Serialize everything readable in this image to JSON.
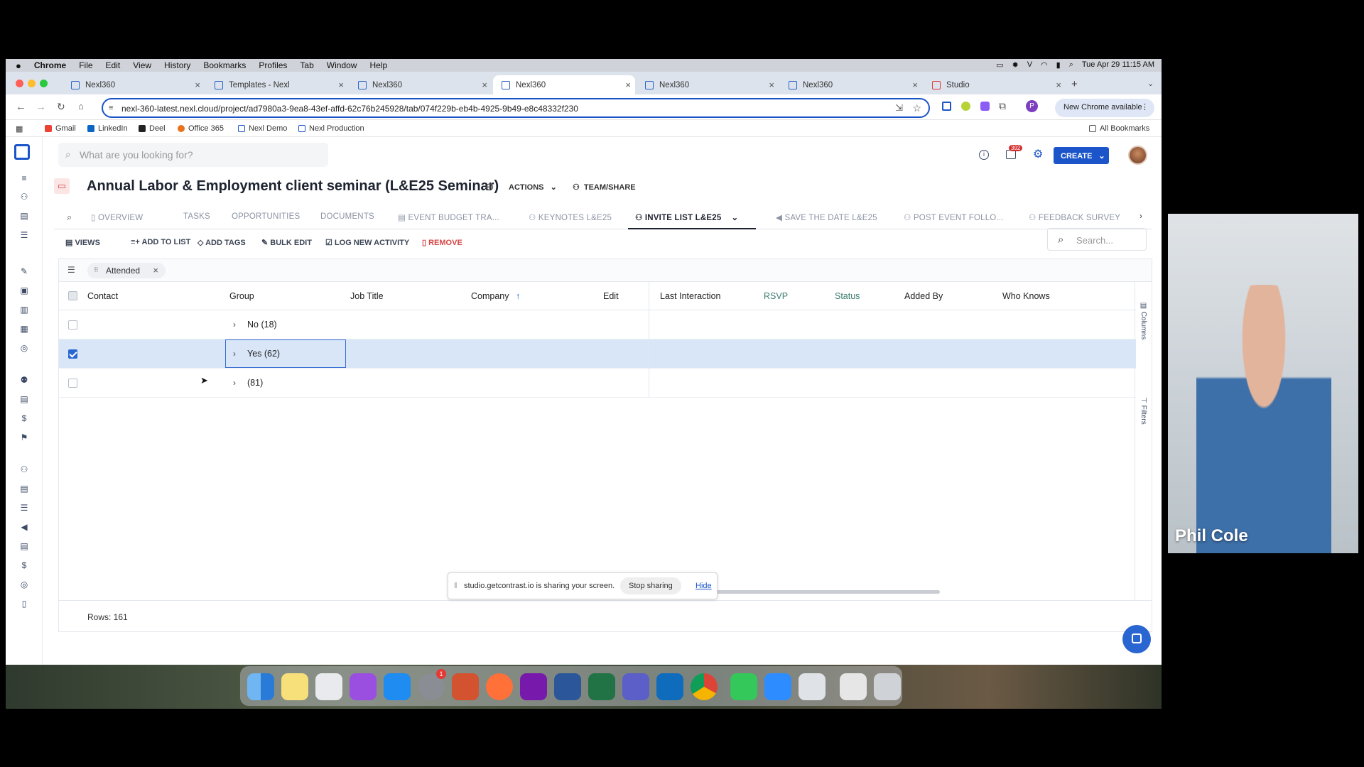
{
  "menubar": {
    "apple": "",
    "items": [
      "Chrome",
      "File",
      "Edit",
      "View",
      "History",
      "Bookmarks",
      "Profiles",
      "Tab",
      "Window",
      "Help"
    ],
    "clock": "Tue Apr 29  11:15 AM"
  },
  "browser": {
    "tabs": [
      "Nexl360",
      "Templates - Nexl",
      "Nexl360",
      "Nexl360",
      "Nexl360",
      "Nexl360",
      "Studio"
    ],
    "active_tab": 3,
    "url": "nexl-360-latest.nexl.cloud/project/ad7980a3-9ea8-43ef-affd-62c76b245928/tab/074f229b-eb4b-4925-9b49-e8c48332f230",
    "new_chrome": "New Chrome available",
    "bookmarks": [
      "Gmail",
      "LinkedIn",
      "Deel",
      "Office 365",
      "Nexl Demo",
      "Nexl Production"
    ],
    "all_bookmarks": "All Bookmarks",
    "profile_initial": "P"
  },
  "app": {
    "search_placeholder": "What are you looking for?",
    "notif_count": "392",
    "create_label": "CREATE",
    "title": "Annual Labor & Employment client seminar (L&E25 Seminar)",
    "actions_label": "ACTIONS",
    "team_share_label": "TEAM/SHARE",
    "tabs": [
      "OVERVIEW",
      "TASKS",
      "OPPORTUNITIES",
      "DOCUMENTS",
      "EVENT BUDGET TRA...",
      "KEYNOTES L&E25",
      "INVITE LIST L&E25",
      "SAVE THE DATE L&E25",
      "POST EVENT FOLLO...",
      "FEEDBACK SURVEY"
    ],
    "toolbar": {
      "views": "VIEWS",
      "add_to_list": "ADD TO LIST",
      "add_tags": "ADD TAGS",
      "bulk_edit": "BULK EDIT",
      "log_activity": "LOG NEW ACTIVITY",
      "remove": "REMOVE"
    },
    "table_search_placeholder": "Search...",
    "filter_chip": "Attended",
    "columns": [
      "Contact",
      "Group",
      "Job Title",
      "Company",
      "Edit",
      "Last Interaction",
      "RSVP",
      "Status",
      "Added By",
      "Who Knows"
    ],
    "rows": [
      {
        "group": "No (18)",
        "selected": false
      },
      {
        "group": "Yes (62)",
        "selected": true
      },
      {
        "group": "(81)",
        "selected": false
      }
    ],
    "side_columns": "Columns",
    "side_filters": "Filters",
    "rows_count": "Rows: 161"
  },
  "share_bar": {
    "text": "studio.getcontrast.io is sharing your screen.",
    "stop": "Stop sharing",
    "hide": "Hide"
  },
  "dock": {
    "badge": "1"
  },
  "webcam": {
    "name": "Phil Cole"
  },
  "colors": {
    "accent": "#1b55c9",
    "remove": "#d64545",
    "selected_row": "#d8e6f8"
  }
}
